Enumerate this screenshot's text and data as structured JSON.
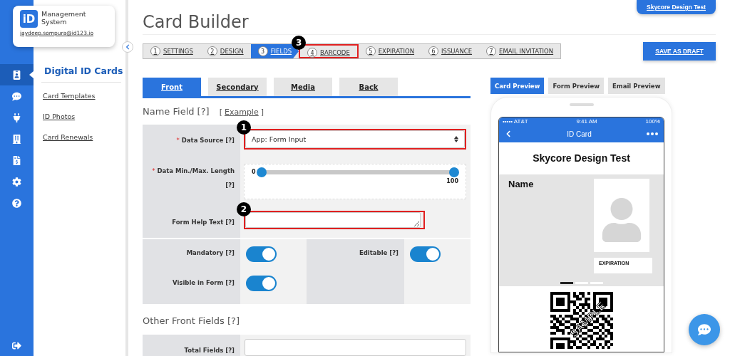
{
  "brand": {
    "logo": "iD",
    "title": "Management System",
    "email": "jaydeep.sompura@id123.io"
  },
  "rail": [
    {
      "kind": "id-card",
      "selected": true
    },
    {
      "kind": "chat",
      "selected": false
    },
    {
      "kind": "plug",
      "selected": false
    },
    {
      "kind": "building",
      "selected": false
    },
    {
      "kind": "invoice",
      "selected": false
    },
    {
      "kind": "settings",
      "selected": false
    },
    {
      "kind": "help",
      "selected": false
    }
  ],
  "sidebar": {
    "title": "Digital ID Cards",
    "items": [
      "Card Templates",
      "ID Photos",
      "Card Renewals"
    ]
  },
  "page_title": "Card Builder",
  "account_button": "Skycore Design Test",
  "steps": [
    {
      "number": "1",
      "label": "SETTINGS",
      "selected": false
    },
    {
      "number": "2",
      "label": "DESIGN",
      "selected": false
    },
    {
      "number": "3",
      "label": "FIELDS",
      "selected": true
    },
    {
      "number": "4",
      "label": "BARCODE",
      "selected": false,
      "callout": "3"
    },
    {
      "number": "5",
      "label": "EXPIRATION",
      "selected": false
    },
    {
      "number": "6",
      "label": "ISSUANCE",
      "selected": false
    },
    {
      "number": "7",
      "label": "EMAIL INVITATION",
      "selected": false
    }
  ],
  "save_button": "SAVE AS DRAFT",
  "field_tabs": [
    {
      "label": "Front",
      "selected": true
    },
    {
      "label": "Secondary",
      "selected": false
    },
    {
      "label": "Media",
      "selected": false
    },
    {
      "label": "Back",
      "selected": false
    }
  ],
  "section": {
    "title": "Name Field [?]",
    "example_open": "[",
    "example_link": "Example",
    "example_close": "]"
  },
  "data_source": {
    "label": "Data Source [?]",
    "required": true,
    "required_mark": "*",
    "value": "App: Form Input",
    "callout": "1"
  },
  "length": {
    "label": "Data Min./Max. Length [?]",
    "required": true,
    "required_mark": "*",
    "min_label": "0",
    "max_label": "100",
    "thumbs": [
      {
        "level": 0
      },
      {
        "level": 1
      }
    ]
  },
  "help_text": {
    "label": "Form Help Text [?]",
    "callout": "2"
  },
  "toggles": [
    {
      "label": "Mandatory [?]",
      "on": true
    },
    {
      "label": "Editable [?]",
      "on": true
    },
    {
      "label": "Visible in Form [?]",
      "on": true
    }
  ],
  "other": {
    "title": "Other Front Fields [?]",
    "total_label": "Total Fields [?]"
  },
  "preview_tabs": [
    {
      "label": "Card Preview",
      "selected": true
    },
    {
      "label": "Form Preview",
      "selected": false
    },
    {
      "label": "Email Preview",
      "selected": false
    }
  ],
  "phone": {
    "carrier": "••••• AT&T",
    "time": "9:41 AM",
    "battery": "100%",
    "nav_title": "ID Card",
    "card_title": "Skycore Design Test",
    "name_label": "Name",
    "expiration": "EXPIRATION",
    "stamp": "SAMPLE",
    "pages": [
      {
        "selected": true
      },
      {
        "selected": false
      },
      {
        "selected": false
      }
    ]
  }
}
